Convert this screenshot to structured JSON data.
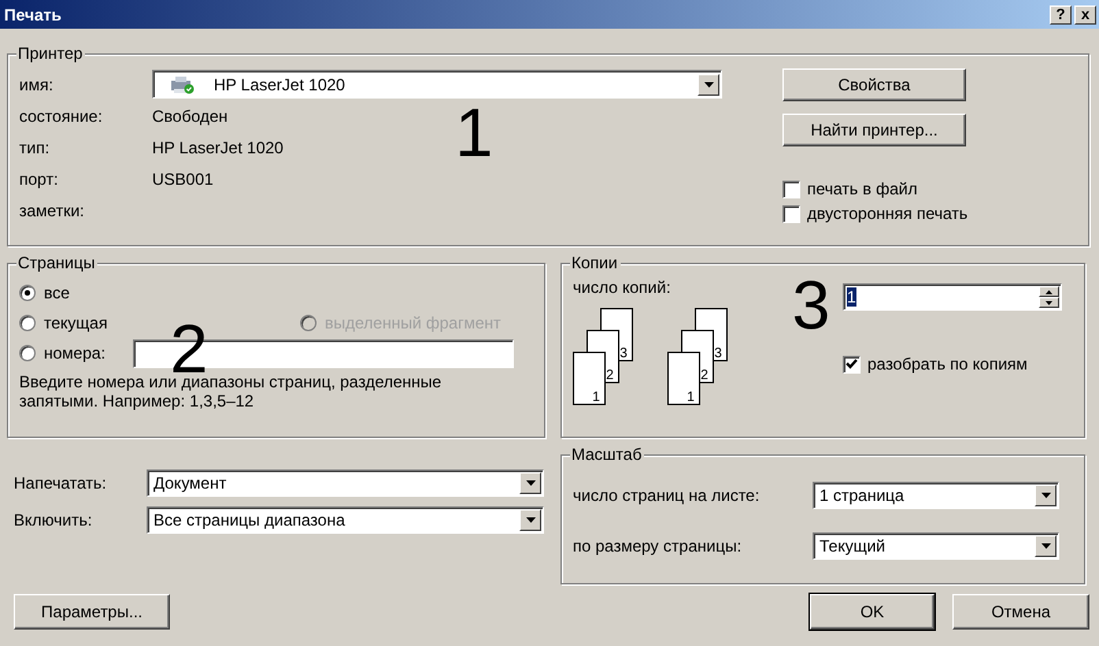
{
  "window": {
    "title": "Печать",
    "help_button": "?",
    "close_button": "x"
  },
  "printer": {
    "legend": "Принтер",
    "name_label": "имя:",
    "name_value": "HP LaserJet 1020",
    "info": [
      {
        "label": "состояние:",
        "value": "Свободен"
      },
      {
        "label": "тип:",
        "value": "HP LaserJet 1020"
      },
      {
        "label": "порт:",
        "value": "USB001"
      },
      {
        "label": "заметки:"
      }
    ],
    "buttons": [
      "Свойства",
      "Найти принтер..."
    ],
    "options": [
      {
        "label": "печать в файл",
        "checked": false
      },
      {
        "label": "двусторонняя печать",
        "checked": false
      }
    ]
  },
  "pages": {
    "legend": "Страницы",
    "options": [
      {
        "label": "все",
        "selected": true,
        "disabled": false
      },
      {
        "label": "текущая",
        "selected": false,
        "disabled": false
      },
      {
        "label": "выделенный фрагмент",
        "selected": false,
        "disabled": true
      },
      {
        "label": "номера:",
        "selected": false,
        "disabled": false
      }
    ],
    "hint": "Введите номера или диапазоны страниц, разделенные запятыми. Например: 1,3,5–12"
  },
  "copies": {
    "legend": "Копии",
    "count_label": "число копий:",
    "count_value": "1",
    "count_value_selected": true,
    "collate_icons": [
      {
        "pages": [
          "1",
          "2",
          "3"
        ]
      },
      {
        "pages": [
          "1",
          "2",
          "3"
        ]
      }
    ],
    "collate": {
      "label": "разобрать по копиям",
      "checked": true
    }
  },
  "print_what": {
    "label": "Напечатать:",
    "value": "Документ"
  },
  "include": {
    "label": "Включить:",
    "value": "Все страницы диапазона"
  },
  "scale": {
    "legend": "Масштаб",
    "rows": [
      {
        "label": "число страниц на листе:",
        "value": "1 страница"
      },
      {
        "label": "по размеру страницы:",
        "value": "Текущий"
      }
    ]
  },
  "buttons": [
    {
      "label": "Параметры...",
      "default": false
    },
    {
      "label": "OK",
      "default": true
    },
    {
      "label": "Отмена",
      "default": false
    }
  ],
  "callouts": [
    {
      "kind": "printer",
      "text": "1"
    },
    {
      "kind": "pages",
      "text": "2"
    },
    {
      "kind": "copies",
      "text": "3"
    }
  ]
}
